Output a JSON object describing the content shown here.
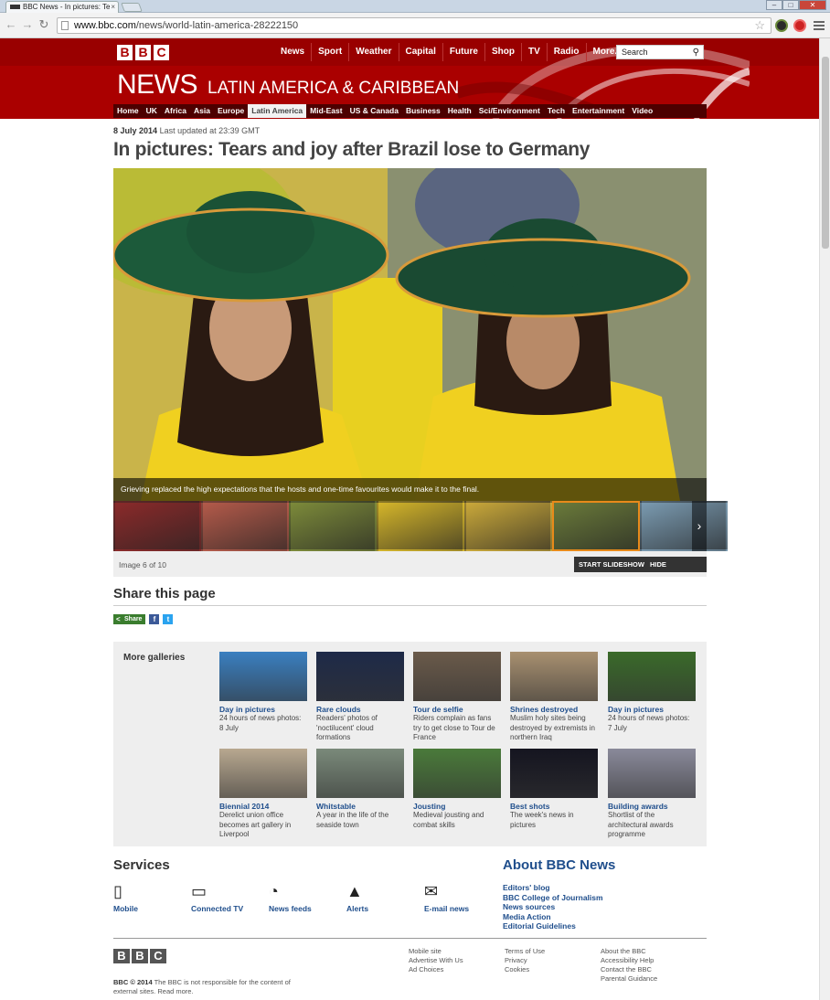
{
  "browser": {
    "tab_title": "BBC News - In pictures: Te",
    "url_prefix": "www.bbc.com",
    "url_path": "/news/world-latin-america-28222150"
  },
  "header": {
    "logo_letters": [
      "B",
      "B",
      "C"
    ],
    "top_nav": [
      "News",
      "Sport",
      "Weather",
      "Capital",
      "Future",
      "Shop",
      "TV",
      "Radio",
      "More..."
    ],
    "search_placeholder": "Search",
    "news_title": "NEWS",
    "section_title": "LATIN AMERICA & CARIBBEAN",
    "sub_nav": [
      "Home",
      "UK",
      "Africa",
      "Asia",
      "Europe",
      "Latin America",
      "Mid-East",
      "US & Canada",
      "Business",
      "Health",
      "Sci/Environment",
      "Tech",
      "Entertainment",
      "Video"
    ],
    "active_sub_nav": "Latin America"
  },
  "article": {
    "date": "8 July 2014",
    "updated": "Last updated at 23:39 GMT",
    "headline": "In pictures: Tears and joy after Brazil lose to Germany"
  },
  "gallery": {
    "caption": "Grieving replaced the high expectations that the hosts and one-time favourites would make it to the final.",
    "image_count": "Image 6 of 10",
    "start_slideshow": "START SLIDESHOW",
    "hide_captions": "HIDE CAPTIONS",
    "thumbnail_colors": [
      "#8a2a2a",
      "#b35a4a",
      "#7c8a3a",
      "#d4b52a",
      "#c9a83a",
      "#6a7a3a",
      "#7a9ab0"
    ],
    "selected_thumb": 5
  },
  "share": {
    "heading": "Share this page",
    "share_label": "Share",
    "facebook": "f",
    "twitter": "t"
  },
  "more_galleries": {
    "heading": "More galleries",
    "items": [
      {
        "title": "Day in pictures",
        "desc": "24 hours of news photos: 8 July",
        "color": "#3a7fc0"
      },
      {
        "title": "Rare clouds",
        "desc": "Readers' photos of 'noctilucent' cloud formations",
        "color": "#1e2a48"
      },
      {
        "title": "Tour de selfie",
        "desc": "Riders complain as fans try to get close to Tour de France",
        "color": "#6a5a4a"
      },
      {
        "title": "Shrines destroyed",
        "desc": "Muslim holy sites being destroyed by extremists in northern Iraq",
        "color": "#a89070"
      },
      {
        "title": "Day in pictures",
        "desc": "24 hours of news photos: 7 July",
        "color": "#3a6a2a"
      },
      {
        "title": "Biennial 2014",
        "desc": "Derelict union office becomes art gallery in Liverpool",
        "color": "#b8a890"
      },
      {
        "title": "Whitstable",
        "desc": "A year in the life of the seaside town",
        "color": "#7a8a7a"
      },
      {
        "title": "Jousting",
        "desc": "Medieval jousting and combat skills",
        "color": "#4a7a3a"
      },
      {
        "title": "Best shots",
        "desc": "The week's news in pictures",
        "color": "#151520"
      },
      {
        "title": "Building awards",
        "desc": "Shortlist of the architectural awards programme",
        "color": "#8a8a9a"
      }
    ]
  },
  "services": {
    "heading": "Services",
    "items": [
      {
        "label": "Mobile",
        "icon": "mobile-icon",
        "glyph": "▯"
      },
      {
        "label": "Connected TV",
        "icon": "tv-icon",
        "glyph": "▭"
      },
      {
        "label": "News feeds",
        "icon": "rss-icon",
        "glyph": "◔"
      },
      {
        "label": "Alerts",
        "icon": "alert-icon",
        "glyph": "▲"
      },
      {
        "label": "E-mail news",
        "icon": "email-icon",
        "glyph": "✉"
      }
    ]
  },
  "about": {
    "heading": "About BBC News",
    "links": [
      "Editors' blog",
      "BBC College of Journalism",
      "News sources",
      "Media Action",
      "Editorial Guidelines"
    ]
  },
  "footer": {
    "copyright_bold": "BBC © 2014",
    "copyright_text": "The BBC is not responsible for the content of external sites. Read more.",
    "col1": [
      "Mobile site",
      "Advertise With Us",
      "Ad Choices"
    ],
    "col2": [
      "Terms of Use",
      "Privacy",
      "Cookies"
    ],
    "col3": [
      "About the BBC",
      "Accessibility Help",
      "Contact the BBC",
      "Parental Guidance"
    ]
  }
}
